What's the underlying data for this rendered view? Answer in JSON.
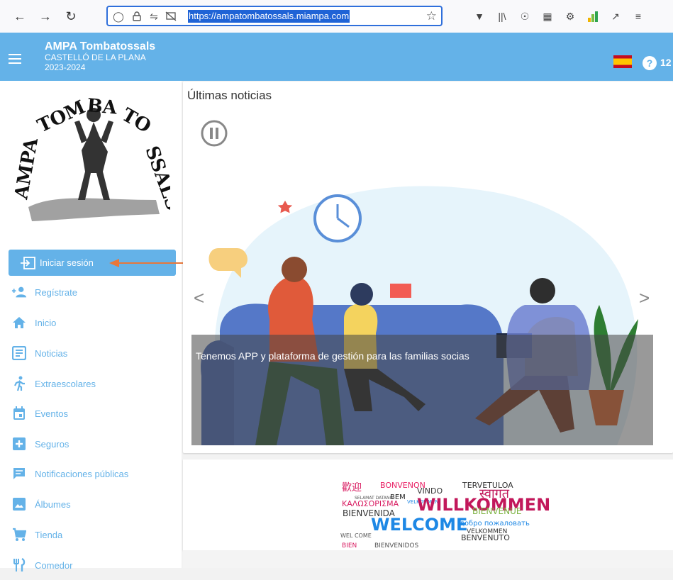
{
  "browser": {
    "url": "https://ampatombatossals.miampa.com",
    "icons": [
      "back-arrow-icon",
      "forward-arrow-icon",
      "reload-icon",
      "shield-icon",
      "lock-icon",
      "permissions-icon",
      "no-camera-icon",
      "bookmark-star-icon",
      "pocket-icon",
      "library-icon",
      "account-icon",
      "grid-icon",
      "extension-gear-icon",
      "stats-icon",
      "share-icon",
      "menu-icon"
    ]
  },
  "header": {
    "org_name": "AMPA Tombatossals",
    "city": "CASTELLÓ DE LA PLANA",
    "year": "2023-2024",
    "help_count": "12",
    "color": "#64b2e8"
  },
  "sidebar": {
    "logo_text": "AMPA TOMBATOSSALS",
    "login_label": "Iniciar sesión",
    "items": [
      {
        "label": "Regístrate",
        "icon": "person-add-icon"
      },
      {
        "label": "Inicio",
        "icon": "home-icon"
      },
      {
        "label": "Noticias",
        "icon": "news-icon"
      },
      {
        "label": "Extraescolares",
        "icon": "running-icon"
      },
      {
        "label": "Eventos",
        "icon": "calendar-icon"
      },
      {
        "label": "Seguros",
        "icon": "plus-box-icon"
      },
      {
        "label": "Notificaciones públicas",
        "icon": "message-icon"
      },
      {
        "label": "Álbumes",
        "icon": "photo-icon"
      },
      {
        "label": "Tienda",
        "icon": "cart-icon"
      },
      {
        "label": "Comedor",
        "icon": "cutlery-icon"
      }
    ]
  },
  "main": {
    "title": "Últimas noticias",
    "slide_caption": "Tenemos APP y plataforma de gestión para las familias socias",
    "prev": "<",
    "next": ">",
    "welcome_words": [
      "歡迎",
      "BONVENON",
      "VINDO",
      "TERVETULOA",
      "SELAMAT DATANG",
      "BEM",
      "स्वागत",
      "ΚΑΛΩΣΟΡΙΣΜΑ",
      "VELKOMMEN",
      "WILLKOMMEN",
      "BIENVENIDA",
      "BIENVENUE",
      "WELCOME",
      "добро пожаловать",
      "BENVENUTO",
      "BIEN",
      "VELKOMMEN",
      "WEL COME",
      "BIENVENIDOS"
    ]
  }
}
